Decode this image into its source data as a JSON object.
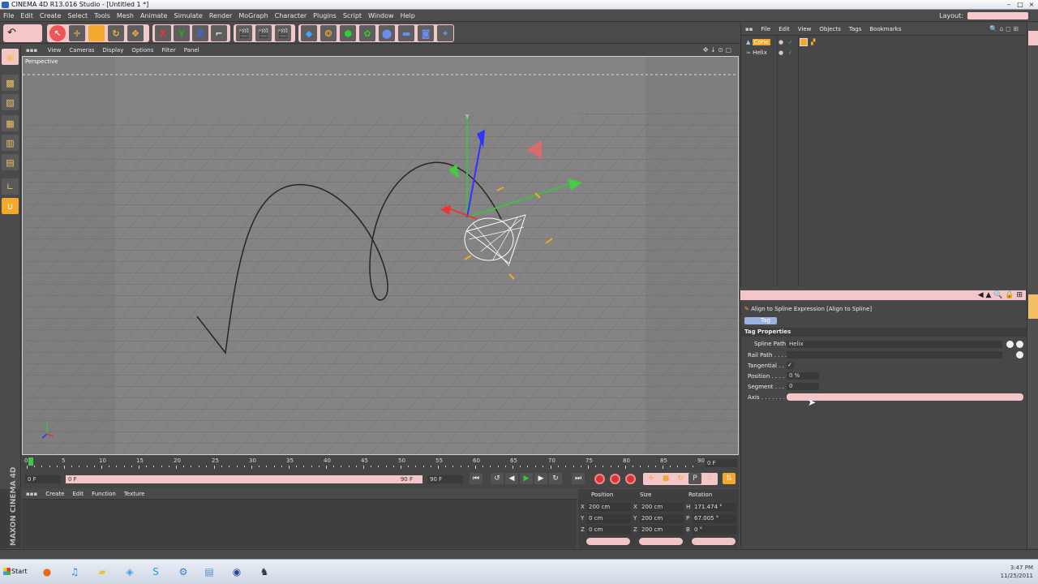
{
  "window": {
    "title": "CINEMA 4D R13.016 Studio - [Untitled 1 *]",
    "min": "–",
    "max": "□",
    "close": "×"
  },
  "menubar": {
    "items": [
      "File",
      "Edit",
      "Create",
      "Select",
      "Tools",
      "Mesh",
      "Animate",
      "Simulate",
      "Render",
      "MoGraph",
      "Character",
      "Plugins",
      "Script",
      "Window",
      "Help"
    ],
    "layout_label": "Layout:"
  },
  "toolbar": {
    "undo_icon": "undo-icon",
    "axis_x": "X",
    "axis_y": "Y",
    "axis_z": "Z"
  },
  "viewport": {
    "menu": [
      "View",
      "Cameras",
      "Display",
      "Options",
      "Filter",
      "Panel"
    ],
    "label": "Perspective",
    "colors": {
      "floor": "#7f7e7e",
      "backdrop": "#8e8a8a",
      "spline": "#2a2a2a",
      "selection": "#ffffff"
    }
  },
  "timeline": {
    "ticks": [
      "0",
      "5",
      "10",
      "15",
      "20",
      "25",
      "30",
      "35",
      "40",
      "45",
      "50",
      "55",
      "60",
      "65",
      "70",
      "75",
      "80",
      "85",
      "90"
    ],
    "current_frame_right": "0 F",
    "start_field": "0 F",
    "range_start": "0 F",
    "range_end": "90 F",
    "end_field": "90 F"
  },
  "material_manager": {
    "menu": [
      "Create",
      "Edit",
      "Function",
      "Texture"
    ]
  },
  "branding": {
    "maxon": "MAXON",
    "product": "CINEMA 4D"
  },
  "coordinates": {
    "headers": {
      "position": "Position",
      "size": "Size",
      "rotation": "Rotation"
    },
    "rows": [
      {
        "axis": "X",
        "pos": "200 cm",
        "size_axis": "X",
        "size": "200 cm",
        "rot_axis": "H",
        "rot": "171.474 °"
      },
      {
        "axis": "Y",
        "pos": "0 cm",
        "size_axis": "Y",
        "size": "200 cm",
        "rot_axis": "P",
        "rot": "67.005 °"
      },
      {
        "axis": "Z",
        "pos": "0 cm",
        "size_axis": "Z",
        "size": "200 cm",
        "rot_axis": "B",
        "rot": "0 °"
      }
    ]
  },
  "object_manager": {
    "menu": [
      "File",
      "Edit",
      "View",
      "Objects",
      "Tags",
      "Bookmarks"
    ],
    "objects": [
      {
        "name": "Cone",
        "selected": true
      },
      {
        "name": "Helix",
        "selected": false
      }
    ]
  },
  "attributes": {
    "title": "Align to Spline Expression [Align to Spline]",
    "tab": "Tag",
    "section": "Tag Properties",
    "rows": [
      {
        "label": "Spline Path",
        "value": "Helix"
      },
      {
        "label": "Rail Path . . . .",
        "value": ""
      },
      {
        "label": "Tangential . .",
        "value": "✓"
      },
      {
        "label": "Position . . . .",
        "value": "0 %"
      },
      {
        "label": "Segment . . .",
        "value": "0"
      },
      {
        "label": "Axis . . . . . . .",
        "value": ""
      }
    ]
  },
  "taskbar": {
    "start": "Start",
    "apps": [
      "firefox-icon",
      "itunes-icon",
      "folder-icon",
      "network-icon",
      "skype-icon",
      "app-icon",
      "document-icon",
      "cinema4d-icon",
      "character-icon"
    ],
    "clock_time": "3:47 PM",
    "clock_date": "11/25/2011"
  }
}
